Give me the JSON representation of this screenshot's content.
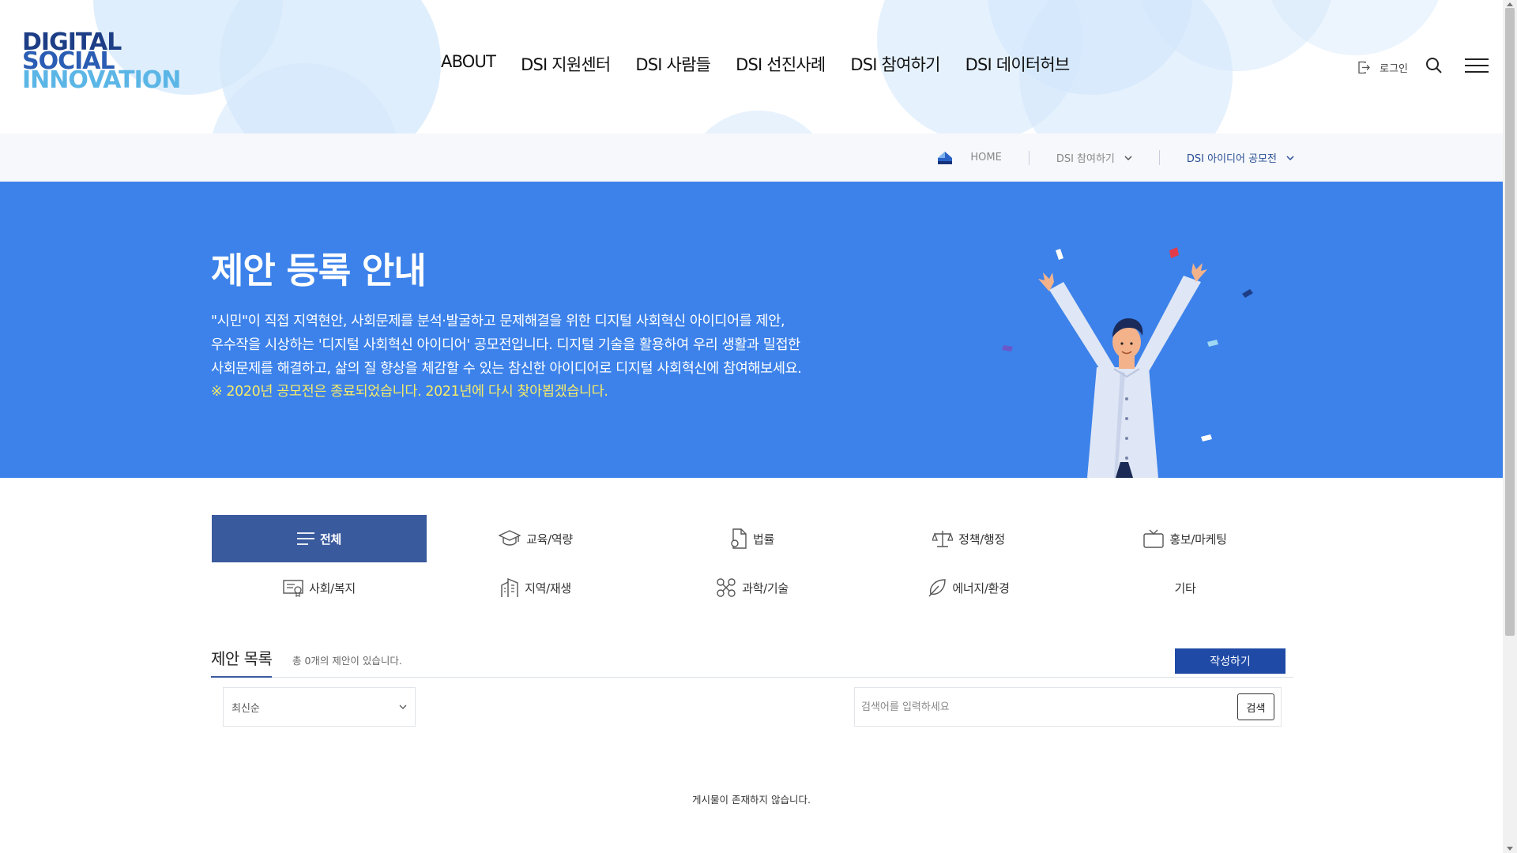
{
  "header": {
    "logo": {
      "line1": "DIGITAL",
      "line2": "SOCIAL",
      "line3": "INNOVATION"
    },
    "nav": [
      {
        "label": "ABOUT"
      },
      {
        "label": "DSI 지원센터"
      },
      {
        "label": "DSI 사람들"
      },
      {
        "label": "DSI 선진사례"
      },
      {
        "label": "DSI 참여하기"
      },
      {
        "label": "DSI 데이터허브"
      }
    ],
    "login_label": "로그인",
    "icons": {
      "login": "login-icon",
      "search": "search-icon",
      "menu": "hamburger-menu-icon"
    }
  },
  "breadcrumb": {
    "home": "HOME",
    "level1": "DSI 참여하기",
    "level2": "DSI 아이디어 공모전"
  },
  "hero": {
    "title": "제안 등록 안내",
    "description_line1": "\"시민\"이 직접 지역현안, 사회문제를 분석·발굴하고 문제해결을 위한 디지털 사회혁신 아이디어를 제안,",
    "description_line2": "우수작을 시상하는 '디지털 사회혁신 아이디어' 공모전입니다. 디지털 기술을 활용하여 우리 생활과 밀접한",
    "description_line3": "사회문제를 해결하고, 삶의 질 향상을 체감할 수 있는 참신한 아이디어로 디지털 사회혁신에 참여해보세요.",
    "notice": "※ 2020년 공모전은 종료되었습니다. 2021년에 다시 찾아뵙겠습니다.",
    "colors": {
      "background": "#3c82ea",
      "notice": "#f4ea6a"
    }
  },
  "categories": [
    {
      "label": "전체",
      "icon": "list-icon",
      "active": true
    },
    {
      "label": "교육/역량",
      "icon": "graduation-cap-icon"
    },
    {
      "label": "법률",
      "icon": "document-icon"
    },
    {
      "label": "정책/행정",
      "icon": "scale-icon"
    },
    {
      "label": "홍보/마케팅",
      "icon": "tv-icon"
    },
    {
      "label": "사회/복지",
      "icon": "certificate-icon"
    },
    {
      "label": "지역/재생",
      "icon": "building-icon"
    },
    {
      "label": "과학/기술",
      "icon": "drone-icon"
    },
    {
      "label": "에너지/환경",
      "icon": "leaf-icon"
    },
    {
      "label": "기타",
      "icon": ""
    }
  ],
  "list": {
    "title": "제안 목록",
    "count_text": "총 0개의 제안이 있습니다.",
    "write_button": "작성하기",
    "sort_selected": "최신순",
    "search_placeholder": "검색어를 입력하세요",
    "search_button": "검색",
    "empty_message": "게시물이 존재하지 않습니다."
  },
  "colors": {
    "accent": "#3a5a9e",
    "write_button": "#1f4aa6"
  }
}
